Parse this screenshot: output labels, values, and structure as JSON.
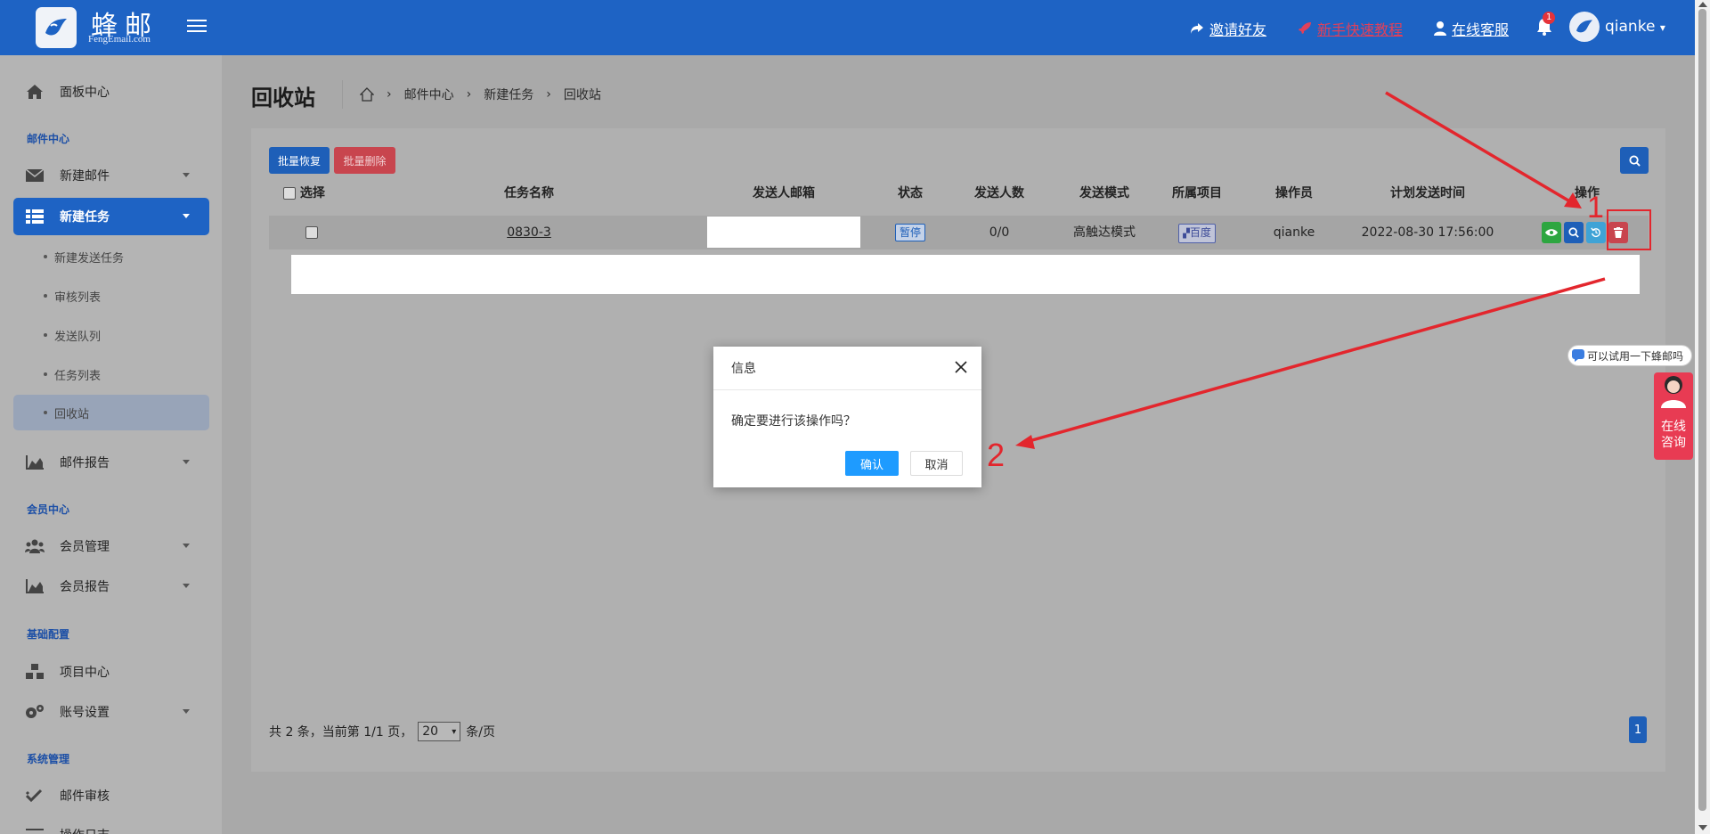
{
  "header": {
    "brand": "蜂邮",
    "brand_sub": "FengEmail.com",
    "links": {
      "invite": "邀请好友",
      "tutorial": "新手快速教程",
      "support": "在线客服"
    },
    "notification_count": "1",
    "username": "qianke"
  },
  "sidebar": {
    "dashboard": "面板中心",
    "sections": {
      "mail": "邮件中心",
      "member": "会员中心",
      "base": "基础配置",
      "system": "系统管理"
    },
    "items": {
      "new_mail": "新建邮件",
      "new_task": "新建任务",
      "mail_report": "邮件报告",
      "member_manage": "会员管理",
      "member_report": "会员报告",
      "project_center": "项目中心",
      "account_settings": "账号设置",
      "mail_review": "邮件审核",
      "op_log": "操作日志"
    },
    "subitems": [
      "新建发送任务",
      "审核列表",
      "发送队列",
      "任务列表",
      "回收站"
    ]
  },
  "page": {
    "title": "回收站",
    "breadcrumb": [
      "邮件中心",
      "新建任务",
      "回收站"
    ]
  },
  "toolbar": {
    "batch_restore": "批量恢复",
    "batch_delete": "批量删除"
  },
  "table": {
    "headers": {
      "select": "选择",
      "task_name": "任务名称",
      "sender": "发送人邮箱",
      "status": "状态",
      "recipients": "发送人数",
      "mode": "发送模式",
      "project": "所属项目",
      "operator": "操作员",
      "scheduled": "计划发送时间",
      "actions": "操作"
    },
    "rows": [
      {
        "task_name": "0830-3",
        "status": "暂停",
        "recipients": "0/0",
        "mode": "高触达模式",
        "project": "百度",
        "operator": "qianke",
        "scheduled": "2022-08-30 17:56:00"
      }
    ]
  },
  "pager": {
    "summary": "共 2 条，当前第 1/1 页，",
    "page_size": "20",
    "per_page": "条/页",
    "current_page": "1"
  },
  "dialog": {
    "title": "信息",
    "message": "确定要进行该操作吗？",
    "confirm": "确认",
    "cancel": "取消"
  },
  "annotations": {
    "step1": "1",
    "step2": "2"
  },
  "chat": {
    "bubble": "可以试用一下蜂邮吗",
    "label_line1": "在线",
    "label_line2": "咨询"
  },
  "colors": {
    "primary": "#1e63c4",
    "danger": "#c8454e",
    "annotation": "#e3262d"
  }
}
